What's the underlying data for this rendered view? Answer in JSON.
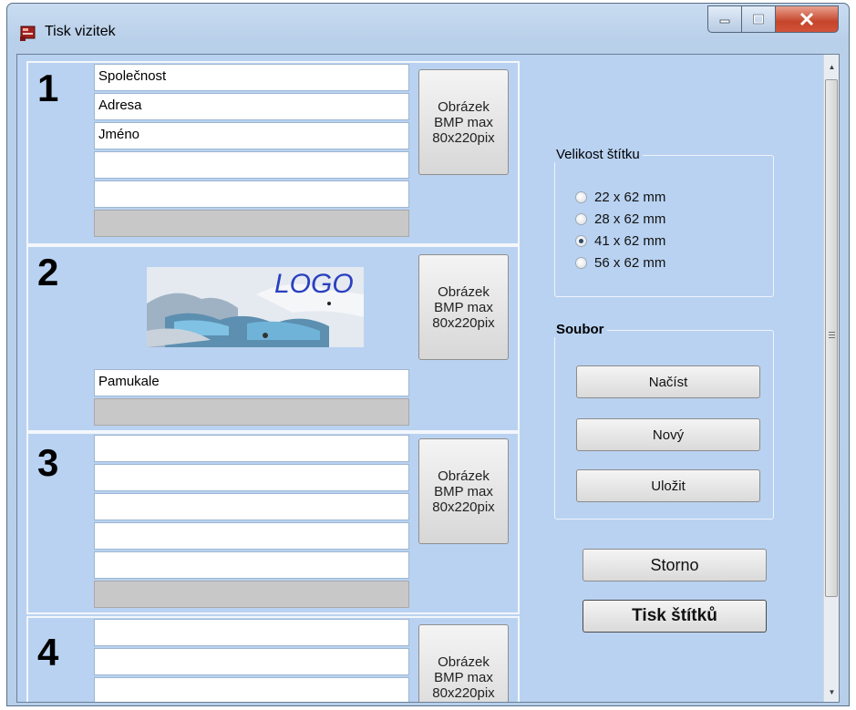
{
  "window": {
    "title": "Tisk vizitek",
    "icon": "cards-app-icon"
  },
  "cards": [
    {
      "number": "1",
      "fields": [
        "Společnost",
        "Adresa",
        "Jméno",
        "",
        ""
      ],
      "image_button": [
        "Obrázek",
        "BMP max",
        "80x220pix"
      ]
    },
    {
      "number": "2",
      "logo_text": "LOGO",
      "fields": [
        "Pamukale"
      ],
      "image_button": [
        "Obrázek",
        "BMP max",
        "80x220pix"
      ]
    },
    {
      "number": "3",
      "fields": [
        "",
        "",
        "",
        "",
        ""
      ],
      "image_button": [
        "Obrázek",
        "BMP max",
        "80x220pix"
      ]
    },
    {
      "number": "4",
      "fields": [
        "",
        "",
        ""
      ],
      "image_button": [
        "Obrázek",
        "BMP max",
        "80x220pix"
      ]
    }
  ],
  "label_size": {
    "legend": "Velikost štítku",
    "options": [
      "22 x 62 mm",
      "28 x 62 mm",
      "41 x 62 mm",
      "56 x 62 mm"
    ],
    "selected": "41 x 62 mm"
  },
  "file_group": {
    "legend": "Soubor",
    "load": "Načíst",
    "new": "Nový",
    "save": "Uložit"
  },
  "actions": {
    "cancel": "Storno",
    "print": "Tisk štítků"
  },
  "colors": {
    "client_bg": "#b9d2f1",
    "close_button": "#c5452a"
  }
}
